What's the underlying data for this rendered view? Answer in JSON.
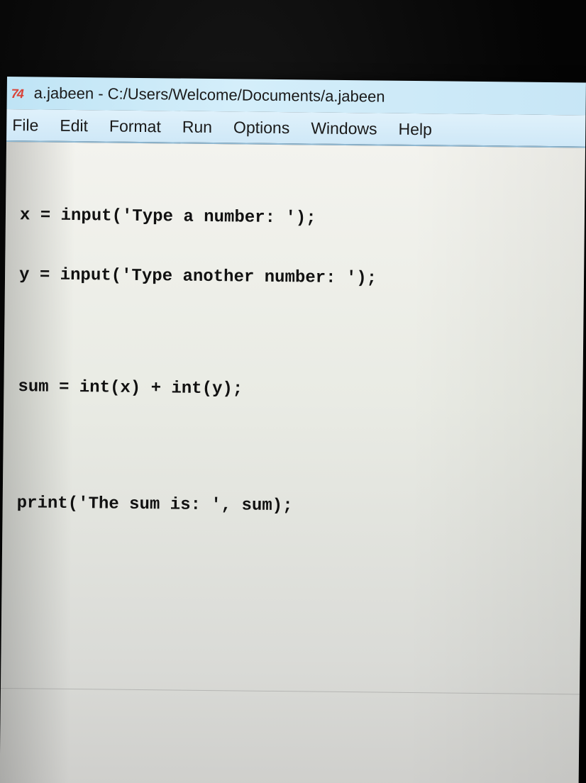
{
  "window": {
    "app_icon": "74",
    "title": "a.jabeen - C:/Users/Welcome/Documents/a.jabeen"
  },
  "menu": {
    "items": [
      "File",
      "Edit",
      "Format",
      "Run",
      "Options",
      "Windows",
      "Help"
    ]
  },
  "editor": {
    "lines": [
      "x = input('Type a number: ');",
      "y = input('Type another number: ');",
      "",
      "sum = int(x) + int(y);",
      "",
      "print('The sum is: ', sum);"
    ]
  },
  "colors": {
    "titlebar": "#c7e6f6",
    "menubar": "#d6ecf9",
    "editor_bg": "#ecede7",
    "icon_red": "#d9443a"
  }
}
